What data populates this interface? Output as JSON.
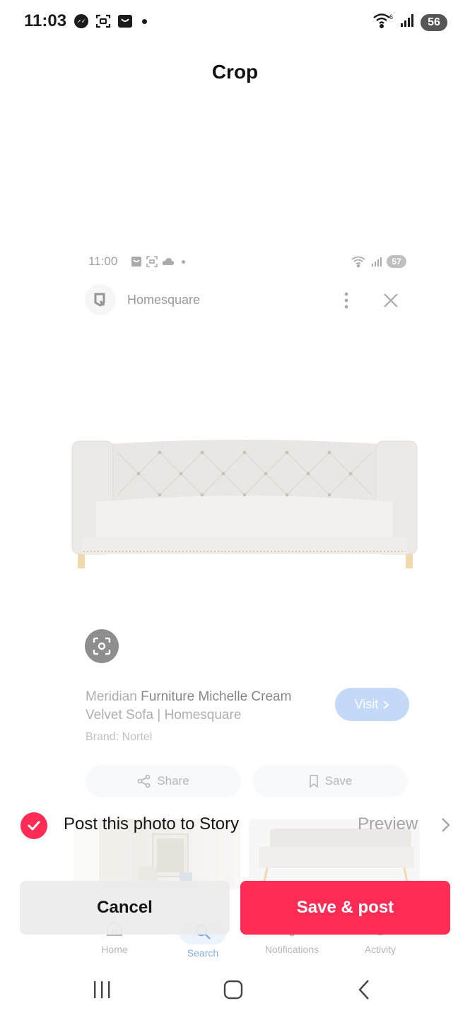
{
  "status_bar": {
    "time": "11:03",
    "battery": "56",
    "icons": [
      "messenger-icon",
      "screenshot-icon",
      "shopping-bag-icon",
      "wifi-icon",
      "signal-icon"
    ]
  },
  "title": "Crop",
  "preview_screenshot": {
    "status_time": "11:00",
    "status_battery": "57",
    "brand": "Homesquare",
    "product_title_light": "Meridian ",
    "product_title_dark": "Furniture Michelle Cream",
    "product_title_line2": "Velvet Sofa | Homesquare",
    "visit_label": "Visit",
    "brand_line": "Brand: Nortel",
    "share_label": "Share",
    "save_label": "Save",
    "nav": {
      "home": "Home",
      "search": "Search",
      "notifications": "Notifications",
      "activity": "Activity"
    }
  },
  "story": {
    "label": "Post this photo to Story",
    "checked": true,
    "preview_label": "Preview"
  },
  "actions": {
    "cancel_label": "Cancel",
    "save_post_label": "Save & post"
  },
  "colors": {
    "accent": "#fe2c55",
    "cancel_bg": "#ececec",
    "visit_bg": "#9fc3f3"
  }
}
